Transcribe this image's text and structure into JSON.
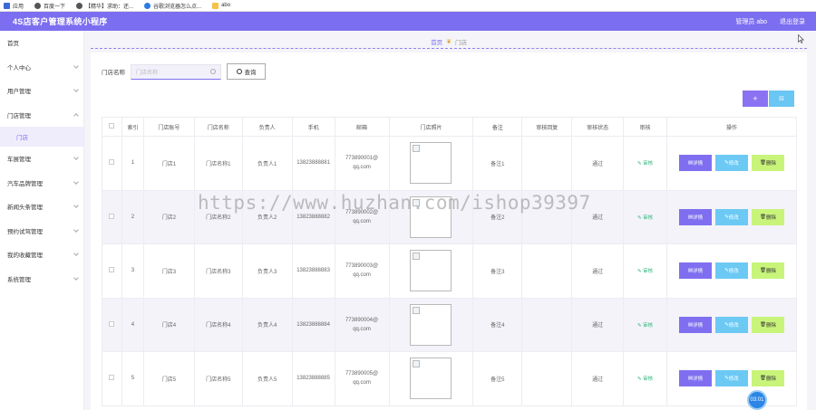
{
  "bookmarks": [
    {
      "label": "应用",
      "icon": "apps-grid-icon"
    },
    {
      "label": "百度一下",
      "icon": "globe-icon"
    },
    {
      "label": "【精华】求助：还...",
      "icon": "globe-icon"
    },
    {
      "label": "谷歌浏览器怎么点...",
      "icon": "paw-icon"
    },
    {
      "label": "abo",
      "icon": "folder-icon"
    }
  ],
  "header": {
    "title": "4S店客户管理系统小程序",
    "role": "管理员 abo",
    "logout": "退出登录"
  },
  "sidebar": {
    "items": [
      {
        "label": "首页",
        "chevron": false
      },
      {
        "label": "个人中心",
        "chevron": true
      },
      {
        "label": "用户管理",
        "chevron": true
      },
      {
        "label": "门店管理",
        "chevron": "up"
      },
      {
        "label": "门店",
        "sub": true
      },
      {
        "label": "车展管理",
        "chevron": true
      },
      {
        "label": "汽车品牌管理",
        "chevron": true
      },
      {
        "label": "新闻头条管理",
        "chevron": true
      },
      {
        "label": "预约试驾管理",
        "chevron": true
      },
      {
        "label": "我的收藏管理",
        "chevron": true
      },
      {
        "label": "系统管理",
        "chevron": true
      }
    ]
  },
  "breadcrumb": {
    "home": "首页",
    "current": "门店"
  },
  "search": {
    "label": "门店名称",
    "placeholder": "门店名称",
    "button": "查询"
  },
  "actions": {
    "add": "+",
    "delete": "⊟"
  },
  "table": {
    "headers": [
      "索引",
      "门店账号",
      "门店名称",
      "负责人",
      "手机",
      "邮箱",
      "门店照片",
      "备注",
      "审核回复",
      "审核状态",
      "审核",
      "操作"
    ],
    "rows": [
      {
        "index": "1",
        "account": "门店1",
        "name": "门店名称1",
        "manager": "负责人1",
        "phone": "13823888881",
        "email1": "773890001@",
        "email2": "qq.com",
        "remark": "备注1",
        "reply": "",
        "status": "通过"
      },
      {
        "index": "2",
        "account": "门店2",
        "name": "门店名称2",
        "manager": "负责人2",
        "phone": "13823888882",
        "email1": "773890002@",
        "email2": "qq.com",
        "remark": "备注2",
        "reply": "",
        "status": "通过"
      },
      {
        "index": "3",
        "account": "门店3",
        "name": "门店名称3",
        "manager": "负责人3",
        "phone": "13823888883",
        "email1": "773890003@",
        "email2": "qq.com",
        "remark": "备注3",
        "reply": "",
        "status": "通过"
      },
      {
        "index": "4",
        "account": "门店4",
        "name": "门店名称4",
        "manager": "负责人4",
        "phone": "13823888884",
        "email1": "773890004@",
        "email2": "qq.com",
        "remark": "备注4",
        "reply": "",
        "status": "通过"
      },
      {
        "index": "5",
        "account": "门店5",
        "name": "门店名称5",
        "manager": "负责人5",
        "phone": "13823888885",
        "email1": "773890005@",
        "email2": "qq.com",
        "remark": "备注5",
        "reply": "",
        "status": "通过"
      }
    ],
    "audit_label": "审核",
    "ops": {
      "detail": "详情",
      "edit": "修改",
      "remove": "删除"
    }
  },
  "watermark": "https://www.huzhan.com/ishop39397",
  "timer": "03:01",
  "colors": {
    "primary": "#7c6ef0",
    "info": "#6cc9f4",
    "lime": "#c8f47a",
    "success": "#2fb57a"
  }
}
